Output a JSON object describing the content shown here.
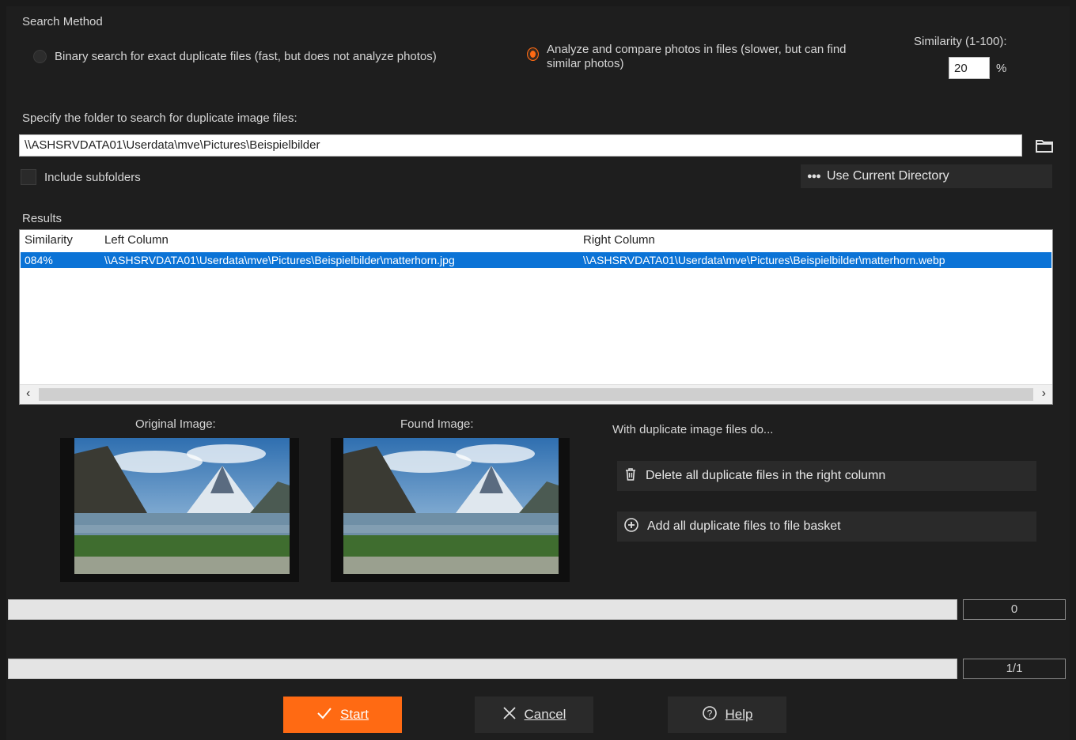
{
  "search_method": {
    "heading": "Search Method",
    "option_binary": "Binary search for exact duplicate files (fast, but does not analyze photos)",
    "option_analyze": "Analyze and compare photos in files (slower, but can find similar photos)",
    "selected": "analyze",
    "similarity_label": "Similarity (1-100):",
    "similarity_value": "20",
    "similarity_unit": "%"
  },
  "folder": {
    "label": "Specify the folder to search for duplicate image files:",
    "path": "\\\\ASHSRVDATA01\\Userdata\\mve\\Pictures\\Beispielbilder",
    "browse_icon": "folder-icon",
    "include_subfolders_label": "Include subfolders",
    "include_subfolders_checked": false,
    "use_current_dir_label": "Use Current Directory"
  },
  "results": {
    "label": "Results",
    "columns": [
      "Similarity",
      "Left Column",
      "Right Column"
    ],
    "rows": [
      {
        "similarity": "084%",
        "left": "\\\\ASHSRVDATA01\\Userdata\\mve\\Pictures\\Beispielbilder\\matterhorn.jpg",
        "right": "\\\\ASHSRVDATA01\\Userdata\\mve\\Pictures\\Beispielbilder\\matterhorn.webp"
      }
    ]
  },
  "preview": {
    "original_label": "Original Image:",
    "found_label": "Found Image:"
  },
  "actions": {
    "heading": "With duplicate image files do...",
    "delete_label": "Delete all duplicate files in the right column",
    "basket_label": "Add all duplicate files to file basket"
  },
  "progress": {
    "bar1_value": 0,
    "bar1_counter": "0",
    "bar2_value": 0,
    "bar2_counter": "1/1"
  },
  "buttons": {
    "start_label": "Start",
    "cancel_label": "Cancel",
    "help_label": "Help"
  },
  "colors": {
    "accent": "#ff6a13",
    "selection": "#0b73d6",
    "background": "#1e1e1e"
  }
}
